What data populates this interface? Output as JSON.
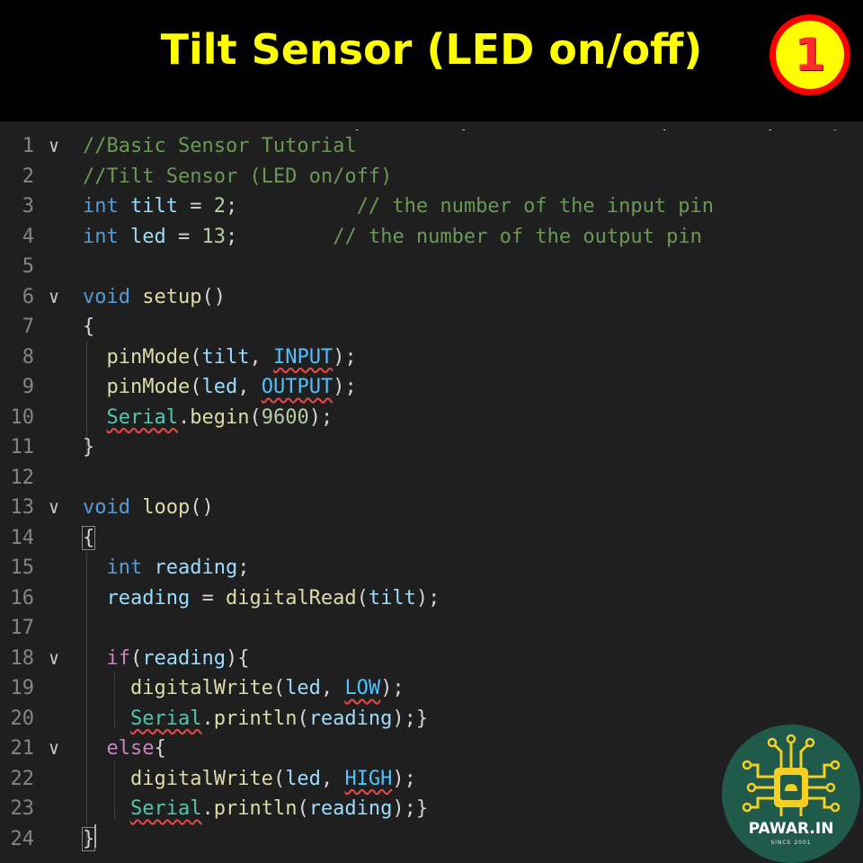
{
  "slide": {
    "title": "Tilt Sensor (LED on/off)",
    "badge_number": "1",
    "title_color": "#ffff00",
    "badge_color": "#ff0000"
  },
  "editor": {
    "theme": "dark",
    "lines": [
      {
        "n": "1",
        "fold": true,
        "tokens": [
          {
            "t": "//Basic Sensor Tutorial",
            "c": "cm"
          }
        ]
      },
      {
        "n": "2",
        "tokens": [
          {
            "t": "//Tilt Sensor (LED on/off)",
            "c": "cm"
          }
        ]
      },
      {
        "n": "3",
        "tokens": [
          {
            "t": "int",
            "c": "kw"
          },
          {
            "t": " "
          },
          {
            "t": "tilt",
            "c": "var"
          },
          {
            "t": " = "
          },
          {
            "t": "2",
            "c": "num"
          },
          {
            "t": ";          "
          },
          {
            "t": "// the number of the input pin",
            "c": "cm"
          }
        ]
      },
      {
        "n": "4",
        "tokens": [
          {
            "t": "int",
            "c": "kw"
          },
          {
            "t": " "
          },
          {
            "t": "led",
            "c": "var"
          },
          {
            "t": " = "
          },
          {
            "t": "13",
            "c": "num"
          },
          {
            "t": ";        "
          },
          {
            "t": "// the number of the output pin",
            "c": "cm"
          }
        ]
      },
      {
        "n": "5",
        "tokens": []
      },
      {
        "n": "6",
        "fold": true,
        "tokens": [
          {
            "t": "void",
            "c": "kw"
          },
          {
            "t": " "
          },
          {
            "t": "setup",
            "c": "fn"
          },
          {
            "t": "()"
          }
        ]
      },
      {
        "n": "7",
        "tokens": [
          {
            "t": "{"
          }
        ]
      },
      {
        "n": "8",
        "tokens": [
          {
            "t": "  "
          },
          {
            "t": "pinMode",
            "c": "fn"
          },
          {
            "t": "("
          },
          {
            "t": "tilt",
            "c": "var"
          },
          {
            "t": ", "
          },
          {
            "t": "INPUT",
            "c": "cst",
            "sq": true
          },
          {
            "t": ");"
          }
        ]
      },
      {
        "n": "9",
        "tokens": [
          {
            "t": "  "
          },
          {
            "t": "pinMode",
            "c": "fn"
          },
          {
            "t": "("
          },
          {
            "t": "led",
            "c": "var"
          },
          {
            "t": ", "
          },
          {
            "t": "OUTPUT",
            "c": "cst",
            "sq": true
          },
          {
            "t": ");"
          }
        ]
      },
      {
        "n": "10",
        "tokens": [
          {
            "t": "  "
          },
          {
            "t": "Serial",
            "c": "cls",
            "sq": true
          },
          {
            "t": "."
          },
          {
            "t": "begin",
            "c": "fn"
          },
          {
            "t": "("
          },
          {
            "t": "9600",
            "c": "num"
          },
          {
            "t": ");"
          }
        ]
      },
      {
        "n": "11",
        "tokens": [
          {
            "t": "}"
          }
        ]
      },
      {
        "n": "12",
        "tokens": []
      },
      {
        "n": "13",
        "fold": true,
        "tokens": [
          {
            "t": "void",
            "c": "kw"
          },
          {
            "t": " "
          },
          {
            "t": "loop",
            "c": "fn"
          },
          {
            "t": "()"
          }
        ]
      },
      {
        "n": "14",
        "tokens": [
          {
            "t": "{",
            "box": true
          }
        ]
      },
      {
        "n": "15",
        "tokens": [
          {
            "t": "  "
          },
          {
            "t": "int",
            "c": "kw"
          },
          {
            "t": " "
          },
          {
            "t": "reading",
            "c": "var"
          },
          {
            "t": ";"
          }
        ]
      },
      {
        "n": "16",
        "tokens": [
          {
            "t": "  "
          },
          {
            "t": "reading",
            "c": "var"
          },
          {
            "t": " = "
          },
          {
            "t": "digitalRead",
            "c": "fn"
          },
          {
            "t": "("
          },
          {
            "t": "tilt",
            "c": "var"
          },
          {
            "t": ");"
          }
        ]
      },
      {
        "n": "17",
        "tokens": []
      },
      {
        "n": "18",
        "fold": true,
        "tokens": [
          {
            "t": "  "
          },
          {
            "t": "if",
            "c": "ctl"
          },
          {
            "t": "("
          },
          {
            "t": "reading",
            "c": "var"
          },
          {
            "t": "){"
          }
        ]
      },
      {
        "n": "19",
        "tokens": [
          {
            "t": "    "
          },
          {
            "t": "digitalWrite",
            "c": "fn"
          },
          {
            "t": "("
          },
          {
            "t": "led",
            "c": "var"
          },
          {
            "t": ", "
          },
          {
            "t": "LOW",
            "c": "cst",
            "sq": true
          },
          {
            "t": ");"
          }
        ]
      },
      {
        "n": "20",
        "tokens": [
          {
            "t": "    "
          },
          {
            "t": "Serial",
            "c": "cls",
            "sq": true
          },
          {
            "t": "."
          },
          {
            "t": "println",
            "c": "fn"
          },
          {
            "t": "("
          },
          {
            "t": "reading",
            "c": "var"
          },
          {
            "t": ");}"
          }
        ]
      },
      {
        "n": "21",
        "fold": true,
        "tokens": [
          {
            "t": "  "
          },
          {
            "t": "else",
            "c": "ctl"
          },
          {
            "t": "{"
          }
        ]
      },
      {
        "n": "22",
        "tokens": [
          {
            "t": "    "
          },
          {
            "t": "digitalWrite",
            "c": "fn"
          },
          {
            "t": "("
          },
          {
            "t": "led",
            "c": "var"
          },
          {
            "t": ", "
          },
          {
            "t": "HIGH",
            "c": "cst",
            "sq": true
          },
          {
            "t": ");"
          }
        ]
      },
      {
        "n": "23",
        "tokens": [
          {
            "t": "    "
          },
          {
            "t": "Serial",
            "c": "cls",
            "sq": true
          },
          {
            "t": "."
          },
          {
            "t": "println",
            "c": "fn"
          },
          {
            "t": "("
          },
          {
            "t": "reading",
            "c": "var"
          },
          {
            "t": ");}"
          }
        ]
      },
      {
        "n": "24",
        "tokens": [
          {
            "t": "}",
            "box": true
          }
        ]
      }
    ]
  },
  "logo": {
    "name": "PAWAR.IN",
    "tagline": "SINCE 2001",
    "icon": "circuit-chip-icon",
    "background": "#1f5a4a"
  }
}
